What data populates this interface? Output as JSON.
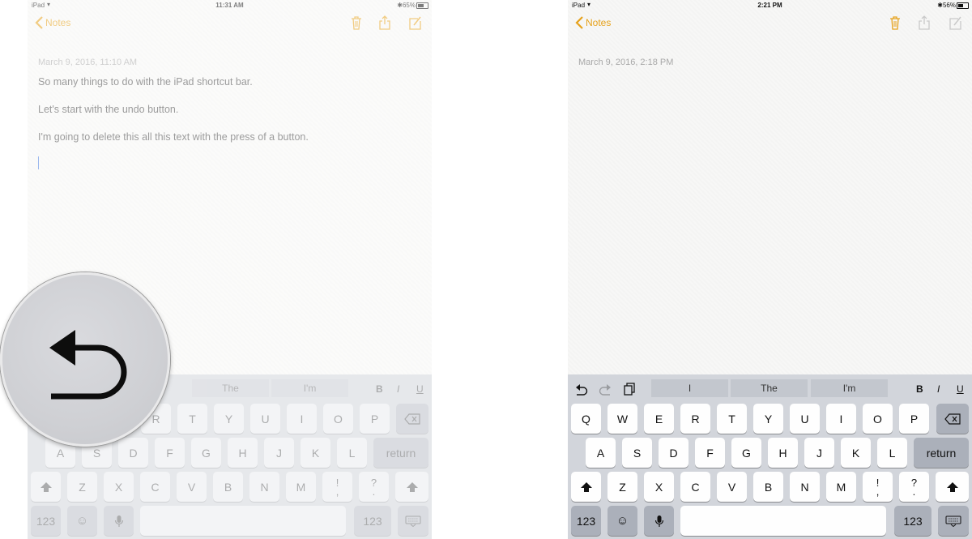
{
  "left": {
    "status": {
      "carrier": "iPad",
      "time": "11:31 AM",
      "battery_pct": "65%",
      "battery_level": 0.65
    },
    "nav": {
      "back_label": "Notes"
    },
    "note": {
      "date": "March 9, 2016, 11:10 AM",
      "lines": [
        "So many things to do with the iPad shortcut bar.",
        "Let's start with the undo button.",
        "I'm going to delete this all this text with the press of a button."
      ]
    },
    "suggestions": [
      "The",
      "I'm"
    ],
    "format": {
      "bold": "B",
      "italic": "I",
      "underline": "U"
    },
    "keys": {
      "row1": [
        "R",
        "T",
        "Y",
        "U",
        "I",
        "O",
        "P"
      ],
      "row2": [
        "A",
        "S",
        "D",
        "F",
        "G",
        "H",
        "J",
        "K",
        "L"
      ],
      "row3": [
        "Z",
        "X",
        "C",
        "V",
        "B",
        "N",
        "M"
      ],
      "return": "return",
      "num": "123",
      "punct1_top": "!",
      "punct1_bottom": ",",
      "punct2_top": "?",
      "punct2_bottom": "."
    }
  },
  "right": {
    "status": {
      "carrier": "iPad",
      "time": "2:21 PM",
      "battery_pct": "56%",
      "battery_level": 0.56
    },
    "nav": {
      "back_label": "Notes"
    },
    "note": {
      "date": "March 9, 2016, 2:18 PM"
    },
    "suggestions": [
      "I",
      "The",
      "I'm"
    ],
    "format": {
      "bold": "B",
      "italic": "I",
      "underline": "U"
    },
    "keys": {
      "row1": [
        "Q",
        "W",
        "E",
        "R",
        "T",
        "Y",
        "U",
        "I",
        "O",
        "P"
      ],
      "row2": [
        "A",
        "S",
        "D",
        "F",
        "G",
        "H",
        "J",
        "K",
        "L"
      ],
      "row3": [
        "Z",
        "X",
        "C",
        "V",
        "B",
        "N",
        "M"
      ],
      "return": "return",
      "num": "123",
      "punct1_top": "!",
      "punct1_bottom": ",",
      "punct2_top": "?",
      "punct2_bottom": "."
    }
  },
  "colors": {
    "accent": "#e6a21c",
    "keyboard_bg": "#d2d5db",
    "key": "#fefefe",
    "key_dark": "#abb0ba"
  },
  "icons": [
    "wifi-icon",
    "bluetooth-icon",
    "battery-icon",
    "trash-icon",
    "share-icon",
    "compose-icon",
    "undo-icon",
    "redo-icon",
    "paste-icon",
    "delete-icon",
    "shift-icon",
    "emoji-icon",
    "microphone-icon",
    "hide-keyboard-icon"
  ]
}
